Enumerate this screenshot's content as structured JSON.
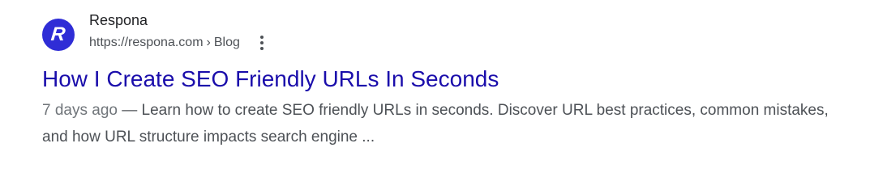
{
  "result": {
    "favicon": {
      "letter": "R",
      "color": "#2f2dd6"
    },
    "site_name": "Respona",
    "url": "https://respona.com",
    "url_separator": "›",
    "breadcrumb": "Blog",
    "more_icon": "more-vert-icon",
    "title": "How I Create SEO Friendly URLs In Seconds",
    "date": "7 days ago",
    "dash": "—",
    "snippet": "Learn how to create SEO friendly URLs in seconds. Discover URL best practices, common mistakes, and how URL structure impacts search engine ..."
  },
  "colors": {
    "title_link": "#1a0dab",
    "text": "#4d5156",
    "site_name": "#202124"
  }
}
